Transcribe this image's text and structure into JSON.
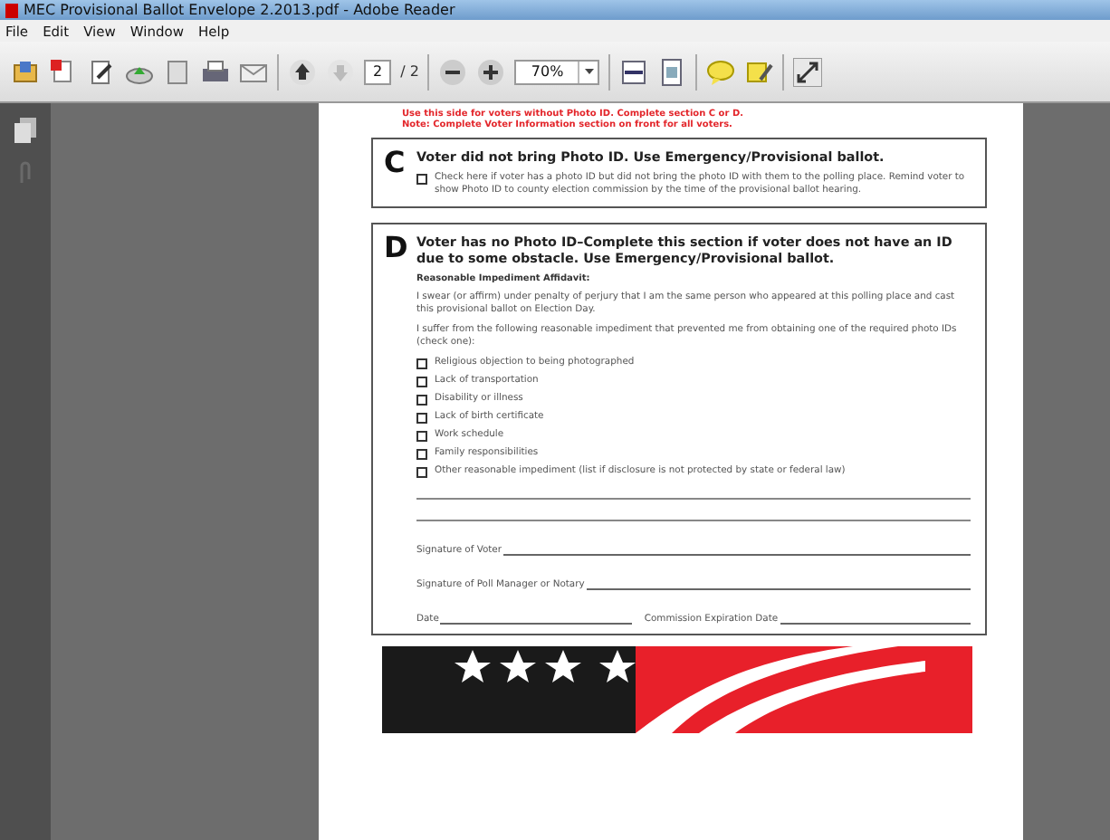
{
  "window": {
    "title": "MEC Provisional Ballot Envelope 2.2013.pdf - Adobe Reader"
  },
  "menu": [
    "File",
    "Edit",
    "View",
    "Window",
    "Help"
  ],
  "toolbar": {
    "page_field": "2",
    "page_total": "/ 2",
    "zoom_field": "70%"
  },
  "document": {
    "notes": [
      "Use this side for voters without Photo ID. Complete section C or D.",
      "Note: Complete Voter Information section on front for all voters."
    ],
    "section_c": {
      "letter": "C",
      "heading": "Voter did not bring Photo ID. Use Emergency/Provisional ballot.",
      "items": [
        {
          "text": "Check here if voter has a photo ID but did not bring the photo ID with them to the polling place. Remind voter to show Photo ID to county election commission by the time of the provisional ballot hearing.",
          "checked": false
        }
      ]
    },
    "section_d": {
      "letter": "D",
      "heading": "Voter has no Photo ID–Complete this section if voter does not have an ID due to some obstacle. Use Emergency/Provisional ballot.",
      "subheading": "Reasonable Impediment Affidavit:",
      "paragraphs": [
        "I swear (or affirm) under penalty of perjury that I am the same person who appeared at this polling place and cast this provisional ballot on Election Day.",
        "I suffer from the following reasonable impediment that prevented me from obtaining one of the required photo IDs (check one):"
      ],
      "items": [
        {
          "text": "Religious objection to being photographed",
          "checked": false
        },
        {
          "text": "Lack of transportation",
          "checked": false
        },
        {
          "text": "Disability or illness",
          "checked": false
        },
        {
          "text": "Lack of birth certificate",
          "checked": false
        },
        {
          "text": "Work schedule",
          "checked": false
        },
        {
          "text": "Family responsibilities",
          "checked": false
        },
        {
          "text": "Other reasonable impediment (list if disclosure is not protected by state or federal law)",
          "checked": false
        }
      ],
      "signatures": [
        "Signature of Voter",
        "Signature of Poll Manager or Notary"
      ],
      "date_label": "Date",
      "expiration_label": "Commission Expiration Date"
    }
  }
}
